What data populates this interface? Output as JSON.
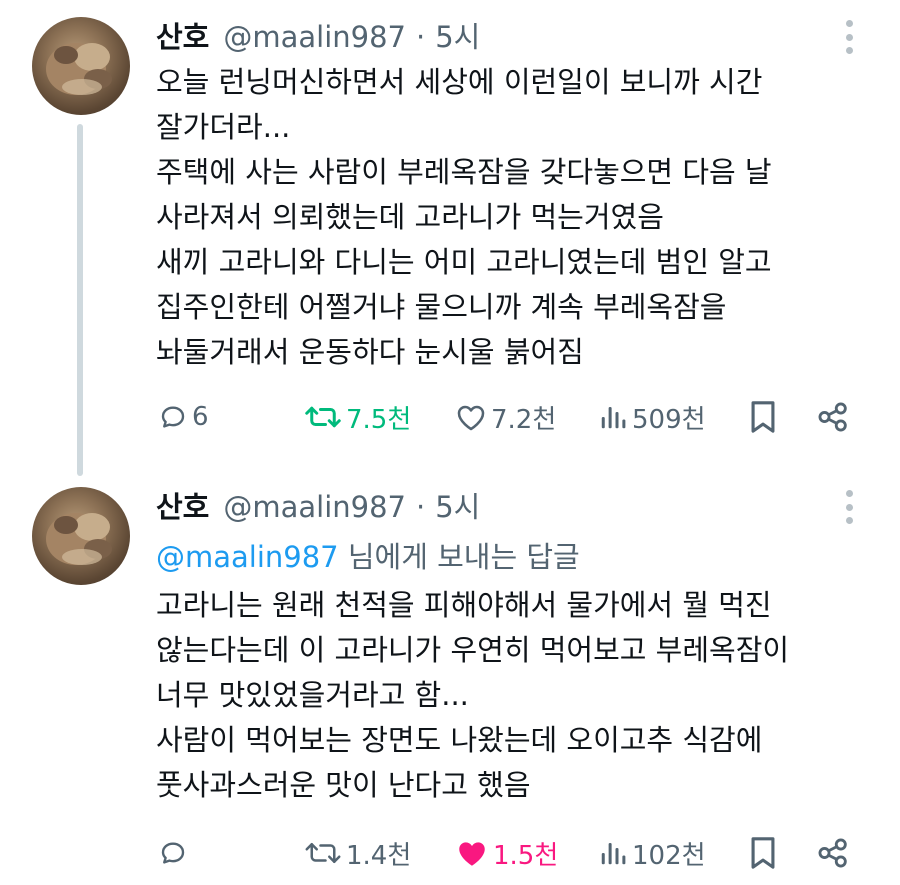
{
  "posts": [
    {
      "author_name": "산호",
      "handle": "@maalin987",
      "separator": "·",
      "time": "5시",
      "body_lines": [
        "오늘 런닝머신하면서 세상에 이런일이 보니까 시간",
        "잘가더라...",
        "주택에 사는 사람이 부레옥잠을 갖다놓으면 다음 날",
        "사라져서 의뢰했는데 고라니가 먹는거였음",
        "새끼 고라니와 다니는 어미 고라니였는데 범인 알고",
        "집주인한테 어쩔거냐 물으니까 계속 부레옥잠을",
        "놔둘거래서 운동하다 눈시울 붉어짐"
      ],
      "actions": {
        "reply_count": "6",
        "repost_count": "7.5천",
        "like_count": "7.2천",
        "view_count": "509천"
      },
      "state": {
        "reposted": true,
        "liked": false
      }
    },
    {
      "author_name": "산호",
      "handle": "@maalin987",
      "separator": "·",
      "time": "5시",
      "reply_to": {
        "mention": "@maalin987",
        "suffix": " 님에게 보내는 답글"
      },
      "body_lines": [
        "고라니는 원래 천적을 피해야해서 물가에서 뭘 먹진",
        "않는다는데 이 고라니가 우연히 먹어보고 부레옥잠이",
        "너무 맛있었을거라고 함...",
        "사람이 먹어보는 장면도 나왔는데 오이고추 식감에",
        "풋사과스러운 맛이 난다고 했음"
      ],
      "actions": {
        "reply_count": "",
        "repost_count": "1.4천",
        "like_count": "1.5천",
        "view_count": "102천"
      },
      "state": {
        "reposted": false,
        "liked": true
      }
    }
  ],
  "icons": {
    "reply": "reply-bubble-icon",
    "repost": "repost-arrows-icon",
    "like": "heart-icon",
    "views": "views-bar-chart-icon",
    "bookmark": "bookmark-icon",
    "share": "share-icon",
    "more": "more-vertical-icon"
  },
  "colors": {
    "text": "#0f1419",
    "secondary": "#536471",
    "link": "#1d9bf0",
    "repost_active": "#00ba7c",
    "like_active": "#f91880",
    "thread_line": "#cfd9de"
  }
}
